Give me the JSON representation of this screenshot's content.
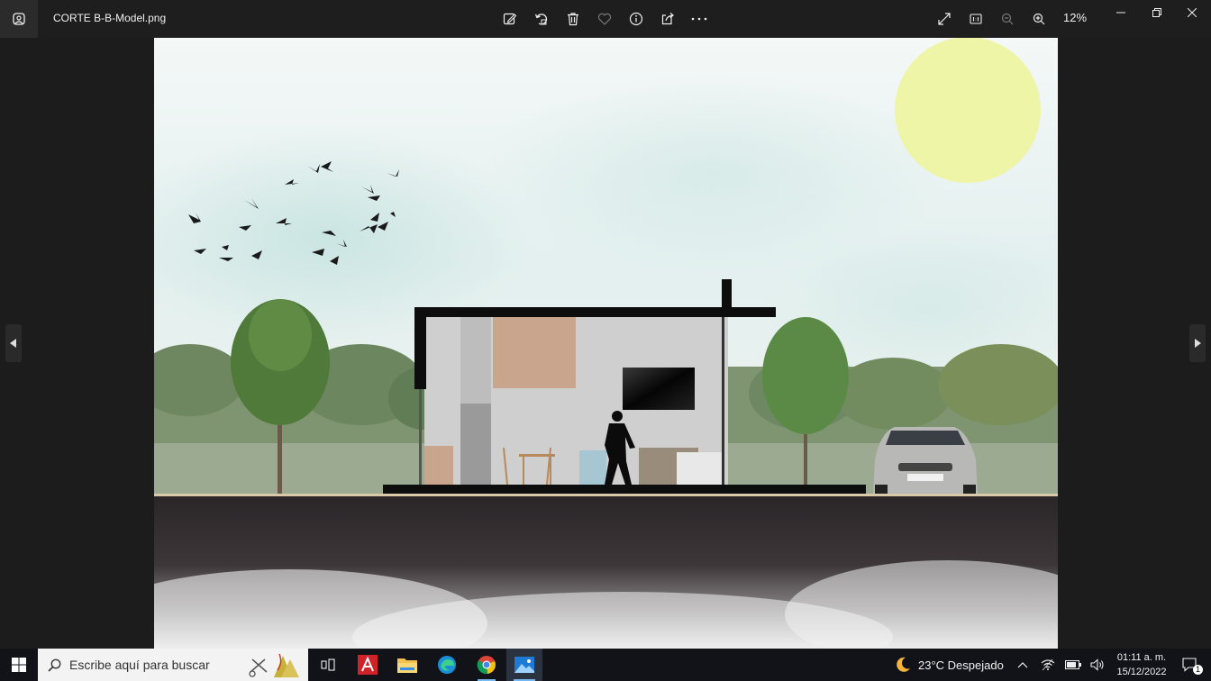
{
  "window": {
    "title": "CORTE B-B-Model.png",
    "zoom_level": "12%"
  },
  "toolbar": {
    "items": [
      "edit-image",
      "rotate",
      "delete",
      "favorite",
      "file-info",
      "share",
      "see-more"
    ]
  },
  "taskbar": {
    "search_placeholder": "Escribe aquí para buscar",
    "weather": "23°C  Despejado",
    "time": "01:11 a. m.",
    "date": "15/12/2022",
    "notification_count": "1",
    "pinned_apps": [
      "task-view",
      "autocad",
      "file-explorer",
      "edge",
      "chrome",
      "photos"
    ]
  },
  "colors": {
    "titlebar": "#1e1e1e",
    "taskbar": "#111318",
    "sky": "#e8f2f2",
    "sun": "#eef5a6",
    "soil": "#2e2a2c"
  }
}
